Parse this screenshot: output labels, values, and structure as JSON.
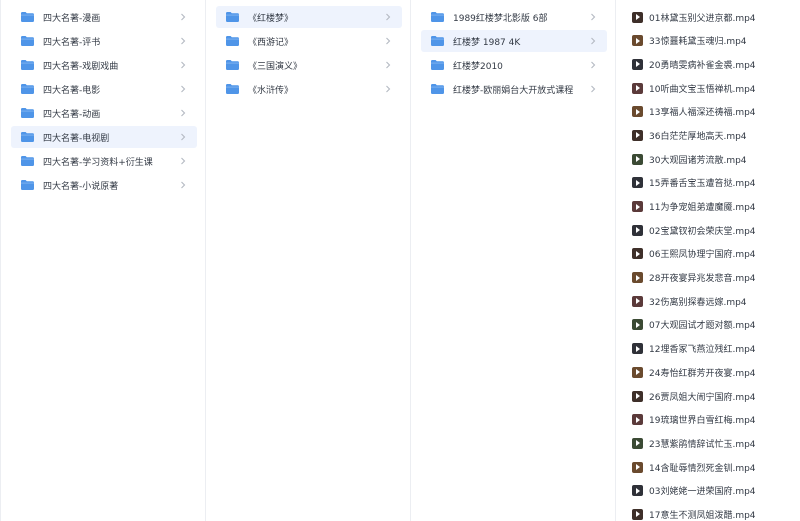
{
  "column1": {
    "items": [
      {
        "label": "四大名著-漫画",
        "selected": false
      },
      {
        "label": "四大名著-评书",
        "selected": false
      },
      {
        "label": "四大名著-戏剧戏曲",
        "selected": false
      },
      {
        "label": "四大名著-电影",
        "selected": false
      },
      {
        "label": "四大名著-动画",
        "selected": false
      },
      {
        "label": "四大名著-电视剧",
        "selected": true
      },
      {
        "label": "四大名著-学习资料+衍生课",
        "selected": false
      },
      {
        "label": "四大名著-小说原著",
        "selected": false
      }
    ]
  },
  "column2": {
    "items": [
      {
        "label": "《红楼梦》",
        "selected": true
      },
      {
        "label": "《西游记》",
        "selected": false
      },
      {
        "label": "《三国演义》",
        "selected": false
      },
      {
        "label": "《水浒传》",
        "selected": false
      }
    ]
  },
  "column3": {
    "items": [
      {
        "label": "1989红楼梦北影版 6部",
        "selected": false
      },
      {
        "label": "红楼梦 1987 4K",
        "selected": true
      },
      {
        "label": "红楼梦2010",
        "selected": false
      },
      {
        "label": "红楼梦-欧丽娟台大开放式课程",
        "selected": false
      }
    ]
  },
  "column4": {
    "files": [
      "01林黛玉别父进京都.mp4",
      "33惊噩耗黛玉魂归.mp4",
      "20勇晴雯病补雀金裘.mp4",
      "10听曲文宝玉悟禅机.mp4",
      "13享福人福深还祷福.mp4",
      "36白茫茫厚地高天.mp4",
      "30大观园诸芳流散.mp4",
      "15弄番舌宝玉遭笞挞.mp4",
      "11为争宠姐弟遭魔魇.mp4",
      "02宝黛钗初会荣庆堂.mp4",
      "06王熙凤协理宁国府.mp4",
      "28开夜宴异兆发悲音.mp4",
      "32伤离别探春远嫁.mp4",
      "07大观园试才题对额.mp4",
      "12埋香冢飞燕泣残红.mp4",
      "24寿怡红群芳开夜宴.mp4",
      "26贾凤姐大闹宁国府.mp4",
      "19琉璃世界白雪红梅.mp4",
      "23慧紫鹃情辞试忙玉.mp4",
      "14含耻辱情烈死金钏.mp4",
      "03刘姥姥一进荣国府.mp4",
      "17意生不测凤姐泼醋.mp4"
    ]
  },
  "colors": {
    "folder": "#4f95e8",
    "selected_bg": "#eef3fd",
    "chevron": "#b4b9c2",
    "divider": "#eceef2",
    "text": "#333a45"
  },
  "icons": {
    "folder": "folder-icon",
    "chevron": "chevron-right-icon",
    "video": "video-file-icon"
  }
}
